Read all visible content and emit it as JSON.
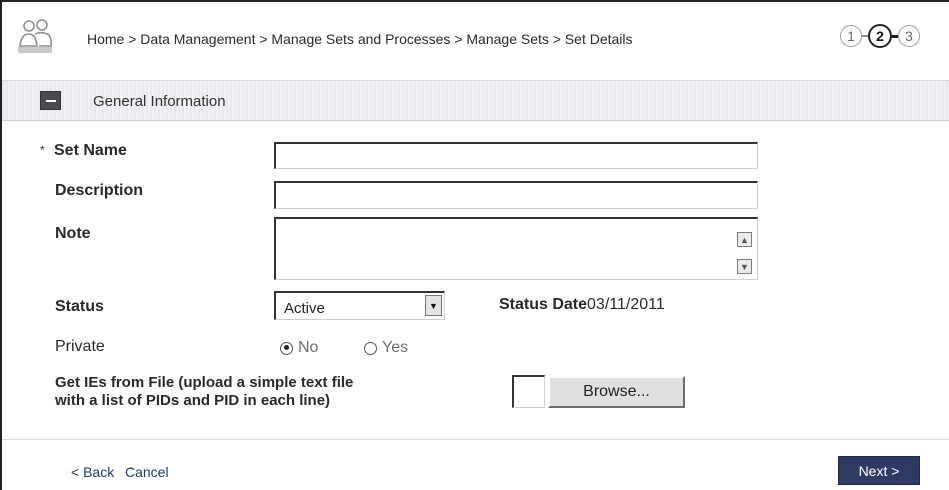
{
  "breadcrumb": "Home > Data Management > Manage Sets and Processes > Manage Sets > Set Details",
  "steps": [
    "1",
    "2",
    "3"
  ],
  "section": {
    "title": "General Information"
  },
  "form": {
    "required_mark": "*",
    "set_name_label": "Set Name",
    "description_label": "Description",
    "note_label": "Note",
    "status_label": "Status",
    "status_value": "Active",
    "status_date_label": "Status Date",
    "status_date_value": "03/11/2011",
    "private_label": "Private",
    "private_options": [
      "No",
      "Yes"
    ],
    "private_selected": "No",
    "file_label_line1": "Get IEs from File (upload a simple text file",
    "file_label_line2": "with a list of PIDs and PID in each line)",
    "browse_label": "Browse..."
  },
  "footer": {
    "back_label": "< Back",
    "cancel_label": "Cancel",
    "next_label": "Next >"
  },
  "colors": {
    "next_button": "#2f3a63",
    "section_bar": "#eeeef2"
  }
}
